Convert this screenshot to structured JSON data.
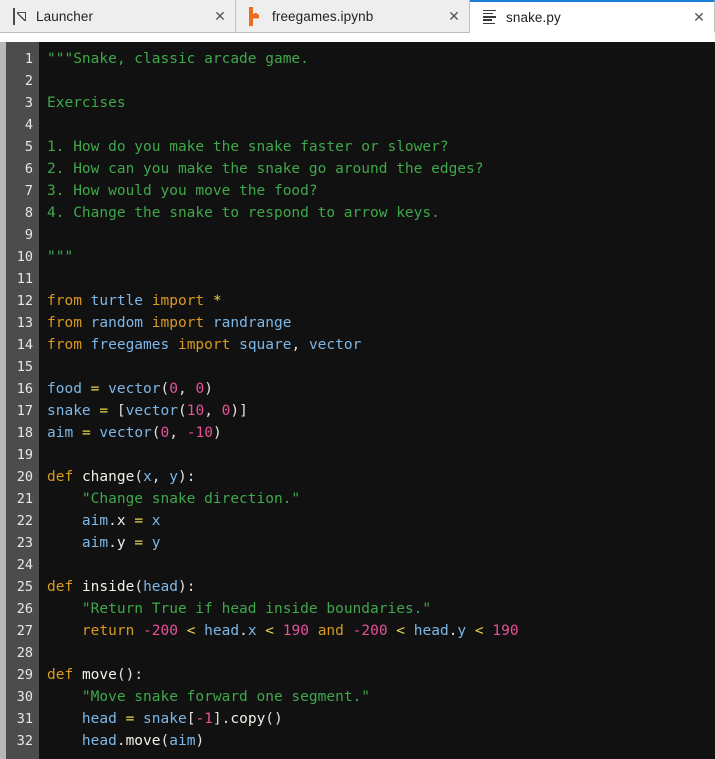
{
  "tabs": [
    {
      "id": "launcher",
      "label": "Launcher",
      "icon": "launch-icon",
      "active": false,
      "close_label": "✕"
    },
    {
      "id": "notebook",
      "label": "freegames.ipynb",
      "icon": "notebook-icon",
      "active": false,
      "close_label": "✕"
    },
    {
      "id": "editor",
      "label": "snake.py",
      "icon": "text-file-icon",
      "active": true,
      "close_label": "✕"
    }
  ],
  "editor": {
    "file_name": "snake.py",
    "language": "Python",
    "first_visible_line": 1,
    "last_visible_line": 32,
    "accent_color": "#1a7fd4",
    "background_color": "#111111",
    "gutter_color": "#4c4c4c",
    "line_numbers": [
      1,
      2,
      3,
      4,
      5,
      6,
      7,
      8,
      9,
      10,
      11,
      12,
      13,
      14,
      15,
      16,
      17,
      18,
      19,
      20,
      21,
      22,
      23,
      24,
      25,
      26,
      27,
      28,
      29,
      30,
      31,
      32
    ],
    "lines": [
      {
        "n": 1,
        "text": "\"\"\"Snake, classic arcade game.",
        "tokens": [
          {
            "t": "\"\"\"Snake, classic arcade game.",
            "c": "doc"
          }
        ]
      },
      {
        "n": 2,
        "text": "",
        "tokens": []
      },
      {
        "n": 3,
        "text": "Exercises",
        "tokens": [
          {
            "t": "Exercises",
            "c": "doc"
          }
        ]
      },
      {
        "n": 4,
        "text": "",
        "tokens": []
      },
      {
        "n": 5,
        "text": "1. How do you make the snake faster or slower?",
        "tokens": [
          {
            "t": "1. How do you make the snake faster or slower?",
            "c": "doc"
          }
        ]
      },
      {
        "n": 6,
        "text": "2. How can you make the snake go around the edges?",
        "tokens": [
          {
            "t": "2. How can you make the snake go around the edges?",
            "c": "doc"
          }
        ]
      },
      {
        "n": 7,
        "text": "3. How would you move the food?",
        "tokens": [
          {
            "t": "3. How would you move the food?",
            "c": "doc"
          }
        ]
      },
      {
        "n": 8,
        "text": "4. Change the snake to respond to arrow keys.",
        "tokens": [
          {
            "t": "4. Change the snake to respond to arrow keys.",
            "c": "doc"
          }
        ]
      },
      {
        "n": 9,
        "text": "",
        "tokens": []
      },
      {
        "n": 10,
        "text": "\"\"\"",
        "tokens": [
          {
            "t": "\"\"\"",
            "c": "doc"
          }
        ]
      },
      {
        "n": 11,
        "text": "",
        "tokens": []
      },
      {
        "n": 12,
        "text": "from turtle import *",
        "tokens": [
          {
            "t": "from",
            "c": "kw"
          },
          {
            "t": " ",
            "c": "plain"
          },
          {
            "t": "turtle",
            "c": "var"
          },
          {
            "t": " ",
            "c": "plain"
          },
          {
            "t": "import",
            "c": "kw"
          },
          {
            "t": " ",
            "c": "plain"
          },
          {
            "t": "*",
            "c": "op"
          }
        ]
      },
      {
        "n": 13,
        "text": "from random import randrange",
        "tokens": [
          {
            "t": "from",
            "c": "kw"
          },
          {
            "t": " ",
            "c": "plain"
          },
          {
            "t": "random",
            "c": "var"
          },
          {
            "t": " ",
            "c": "plain"
          },
          {
            "t": "import",
            "c": "kw"
          },
          {
            "t": " ",
            "c": "plain"
          },
          {
            "t": "randrange",
            "c": "var"
          }
        ]
      },
      {
        "n": 14,
        "text": "from freegames import square, vector",
        "tokens": [
          {
            "t": "from",
            "c": "kw"
          },
          {
            "t": " ",
            "c": "plain"
          },
          {
            "t": "freegames",
            "c": "var"
          },
          {
            "t": " ",
            "c": "plain"
          },
          {
            "t": "import",
            "c": "kw"
          },
          {
            "t": " ",
            "c": "plain"
          },
          {
            "t": "square",
            "c": "var"
          },
          {
            "t": ", ",
            "c": "pun"
          },
          {
            "t": "vector",
            "c": "var"
          }
        ]
      },
      {
        "n": 15,
        "text": "",
        "tokens": []
      },
      {
        "n": 16,
        "text": "food = vector(0, 0)",
        "tokens": [
          {
            "t": "food",
            "c": "var"
          },
          {
            "t": " ",
            "c": "plain"
          },
          {
            "t": "=",
            "c": "op"
          },
          {
            "t": " ",
            "c": "plain"
          },
          {
            "t": "vector",
            "c": "var"
          },
          {
            "t": "(",
            "c": "pun"
          },
          {
            "t": "0",
            "c": "num"
          },
          {
            "t": ", ",
            "c": "pun"
          },
          {
            "t": "0",
            "c": "num"
          },
          {
            "t": ")",
            "c": "pun"
          }
        ]
      },
      {
        "n": 17,
        "text": "snake = [vector(10, 0)]",
        "tokens": [
          {
            "t": "snake",
            "c": "var"
          },
          {
            "t": " ",
            "c": "plain"
          },
          {
            "t": "=",
            "c": "op"
          },
          {
            "t": " ",
            "c": "plain"
          },
          {
            "t": "[",
            "c": "pun"
          },
          {
            "t": "vector",
            "c": "var"
          },
          {
            "t": "(",
            "c": "pun"
          },
          {
            "t": "10",
            "c": "num"
          },
          {
            "t": ", ",
            "c": "pun"
          },
          {
            "t": "0",
            "c": "num"
          },
          {
            "t": ")]",
            "c": "pun"
          }
        ]
      },
      {
        "n": 18,
        "text": "aim = vector(0, -10)",
        "tokens": [
          {
            "t": "aim",
            "c": "var"
          },
          {
            "t": " ",
            "c": "plain"
          },
          {
            "t": "=",
            "c": "op"
          },
          {
            "t": " ",
            "c": "plain"
          },
          {
            "t": "vector",
            "c": "var"
          },
          {
            "t": "(",
            "c": "pun"
          },
          {
            "t": "0",
            "c": "num"
          },
          {
            "t": ", ",
            "c": "pun"
          },
          {
            "t": "-10",
            "c": "num"
          },
          {
            "t": ")",
            "c": "pun"
          }
        ]
      },
      {
        "n": 19,
        "text": "",
        "tokens": []
      },
      {
        "n": 20,
        "text": "def change(x, y):",
        "tokens": [
          {
            "t": "def",
            "c": "def"
          },
          {
            "t": " ",
            "c": "plain"
          },
          {
            "t": "change",
            "c": "fn"
          },
          {
            "t": "(",
            "c": "pun"
          },
          {
            "t": "x",
            "c": "var"
          },
          {
            "t": ", ",
            "c": "pun"
          },
          {
            "t": "y",
            "c": "var"
          },
          {
            "t": "):",
            "c": "pun"
          }
        ]
      },
      {
        "n": 21,
        "text": "    \"Change snake direction.\"",
        "tokens": [
          {
            "t": "    ",
            "c": "plain"
          },
          {
            "t": "\"Change snake direction.\"",
            "c": "str"
          }
        ]
      },
      {
        "n": 22,
        "text": "    aim.x = x",
        "tokens": [
          {
            "t": "    ",
            "c": "plain"
          },
          {
            "t": "aim",
            "c": "var"
          },
          {
            "t": ".",
            "c": "pun"
          },
          {
            "t": "x",
            "c": "fn"
          },
          {
            "t": " ",
            "c": "plain"
          },
          {
            "t": "=",
            "c": "op"
          },
          {
            "t": " ",
            "c": "plain"
          },
          {
            "t": "x",
            "c": "var"
          }
        ]
      },
      {
        "n": 23,
        "text": "    aim.y = y",
        "tokens": [
          {
            "t": "    ",
            "c": "plain"
          },
          {
            "t": "aim",
            "c": "var"
          },
          {
            "t": ".",
            "c": "pun"
          },
          {
            "t": "y",
            "c": "fn"
          },
          {
            "t": " ",
            "c": "plain"
          },
          {
            "t": "=",
            "c": "op"
          },
          {
            "t": " ",
            "c": "plain"
          },
          {
            "t": "y",
            "c": "var"
          }
        ]
      },
      {
        "n": 24,
        "text": "",
        "tokens": []
      },
      {
        "n": 25,
        "text": "def inside(head):",
        "tokens": [
          {
            "t": "def",
            "c": "def"
          },
          {
            "t": " ",
            "c": "plain"
          },
          {
            "t": "inside",
            "c": "fn"
          },
          {
            "t": "(",
            "c": "pun"
          },
          {
            "t": "head",
            "c": "var"
          },
          {
            "t": "):",
            "c": "pun"
          }
        ]
      },
      {
        "n": 26,
        "text": "    \"Return True if head inside boundaries.\"",
        "tokens": [
          {
            "t": "    ",
            "c": "plain"
          },
          {
            "t": "\"Return True if head inside boundaries.\"",
            "c": "str"
          }
        ]
      },
      {
        "n": 27,
        "text": "    return -200 < head.x < 190 and -200 < head.y < 190",
        "tokens": [
          {
            "t": "    ",
            "c": "plain"
          },
          {
            "t": "return",
            "c": "kw"
          },
          {
            "t": " ",
            "c": "plain"
          },
          {
            "t": "-200",
            "c": "num"
          },
          {
            "t": " ",
            "c": "plain"
          },
          {
            "t": "<",
            "c": "op"
          },
          {
            "t": " ",
            "c": "plain"
          },
          {
            "t": "head",
            "c": "var"
          },
          {
            "t": ".",
            "c": "pun"
          },
          {
            "t": "x",
            "c": "var"
          },
          {
            "t": " ",
            "c": "plain"
          },
          {
            "t": "<",
            "c": "op"
          },
          {
            "t": " ",
            "c": "plain"
          },
          {
            "t": "190",
            "c": "num"
          },
          {
            "t": " ",
            "c": "plain"
          },
          {
            "t": "and",
            "c": "kw"
          },
          {
            "t": " ",
            "c": "plain"
          },
          {
            "t": "-200",
            "c": "num"
          },
          {
            "t": " ",
            "c": "plain"
          },
          {
            "t": "<",
            "c": "op"
          },
          {
            "t": " ",
            "c": "plain"
          },
          {
            "t": "head",
            "c": "var"
          },
          {
            "t": ".",
            "c": "pun"
          },
          {
            "t": "y",
            "c": "var"
          },
          {
            "t": " ",
            "c": "plain"
          },
          {
            "t": "<",
            "c": "op"
          },
          {
            "t": " ",
            "c": "plain"
          },
          {
            "t": "190",
            "c": "num"
          }
        ]
      },
      {
        "n": 28,
        "text": "",
        "tokens": []
      },
      {
        "n": 29,
        "text": "def move():",
        "tokens": [
          {
            "t": "def",
            "c": "def"
          },
          {
            "t": " ",
            "c": "plain"
          },
          {
            "t": "move",
            "c": "fn"
          },
          {
            "t": "():",
            "c": "pun"
          }
        ]
      },
      {
        "n": 30,
        "text": "    \"Move snake forward one segment.\"",
        "tokens": [
          {
            "t": "    ",
            "c": "plain"
          },
          {
            "t": "\"Move snake forward one segment.\"",
            "c": "str"
          }
        ]
      },
      {
        "n": 31,
        "text": "    head = snake[-1].copy()",
        "tokens": [
          {
            "t": "    ",
            "c": "plain"
          },
          {
            "t": "head",
            "c": "var"
          },
          {
            "t": " ",
            "c": "plain"
          },
          {
            "t": "=",
            "c": "op"
          },
          {
            "t": " ",
            "c": "plain"
          },
          {
            "t": "snake",
            "c": "var"
          },
          {
            "t": "[",
            "c": "pun"
          },
          {
            "t": "-1",
            "c": "num"
          },
          {
            "t": "].",
            "c": "pun"
          },
          {
            "t": "copy",
            "c": "fn"
          },
          {
            "t": "()",
            "c": "pun"
          }
        ]
      },
      {
        "n": 32,
        "text": "    head.move(aim)",
        "tokens": [
          {
            "t": "    ",
            "c": "plain"
          },
          {
            "t": "head",
            "c": "var"
          },
          {
            "t": ".",
            "c": "pun"
          },
          {
            "t": "move",
            "c": "fn"
          },
          {
            "t": "(",
            "c": "pun"
          },
          {
            "t": "aim",
            "c": "var"
          },
          {
            "t": ")",
            "c": "pun"
          }
        ]
      }
    ]
  },
  "syntax_colors": {
    "string": "#3ea84a",
    "keyword": "#d99a1e",
    "function": "#f2f0e6",
    "variable": "#7cb7e8",
    "number": "#e8519a",
    "operator": "#e5d84a",
    "punctuation": "#e0e0e0"
  }
}
